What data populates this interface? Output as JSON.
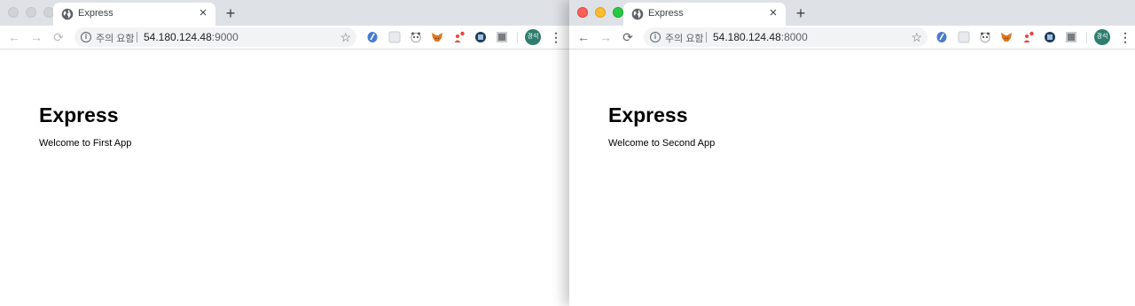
{
  "windows": [
    {
      "tab": {
        "title": "Express",
        "close": "×",
        "new_tab": "+"
      },
      "nav": {
        "back": "←",
        "forward": "→",
        "reload": "⟳"
      },
      "omnibox": {
        "info": "i",
        "security_text": "주의 요함",
        "host": "54.180.124.48",
        "port": ":9000",
        "bookmark": "☆"
      },
      "profile": "경석",
      "menu": "⋮",
      "page": {
        "heading": "Express",
        "text": "Welcome to First App"
      }
    },
    {
      "tab": {
        "title": "Express",
        "close": "×",
        "new_tab": "+"
      },
      "nav": {
        "back": "←",
        "forward": "→",
        "reload": "⟳"
      },
      "omnibox": {
        "info": "i",
        "security_text": "주의 요함",
        "host": "54.180.124.48",
        "port": ":8000",
        "bookmark": "☆"
      },
      "profile": "경석",
      "menu": "⋮",
      "page": {
        "heading": "Express",
        "text": "Welcome to Second App"
      }
    }
  ],
  "extensions": [
    "edit-icon",
    "grid-icon",
    "panda-icon",
    "metamask-fox-icon",
    "people-icon",
    "globe-badge-icon",
    "photo-icon"
  ],
  "colors": {
    "tabstrip": "#dee1e6",
    "omnibox": "#f1f3f4",
    "profile": "#2e7d6e",
    "close_light": "#fe5f57",
    "min_light": "#febc2e",
    "max_light": "#28c840"
  }
}
